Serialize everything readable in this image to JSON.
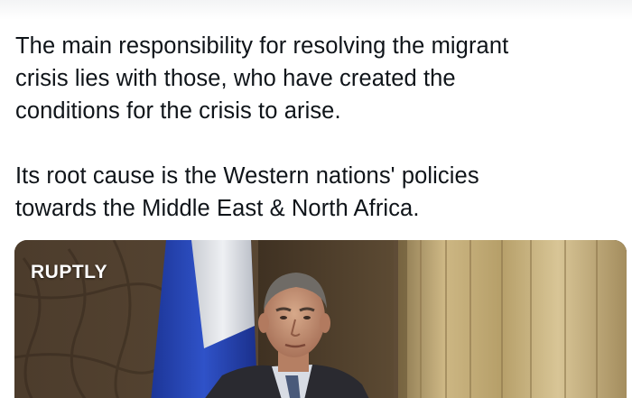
{
  "tweet": {
    "paragraphs": [
      [
        "The main responsibility for resolving the migrant",
        "crisis lies with those, who have created the",
        "conditions for the crisis to arise."
      ],
      [
        "Its root cause is the Western nations' policies",
        "towards the Middle East & North Africa."
      ]
    ]
  },
  "media": {
    "watermark": "RUPTLY",
    "type": "video-still"
  },
  "colors": {
    "text": "#0f1419",
    "background": "#ffffff",
    "flag_white": "#e9ebef",
    "flag_blue": "#2a48b8",
    "curtain_gold": "#c9b27a"
  }
}
